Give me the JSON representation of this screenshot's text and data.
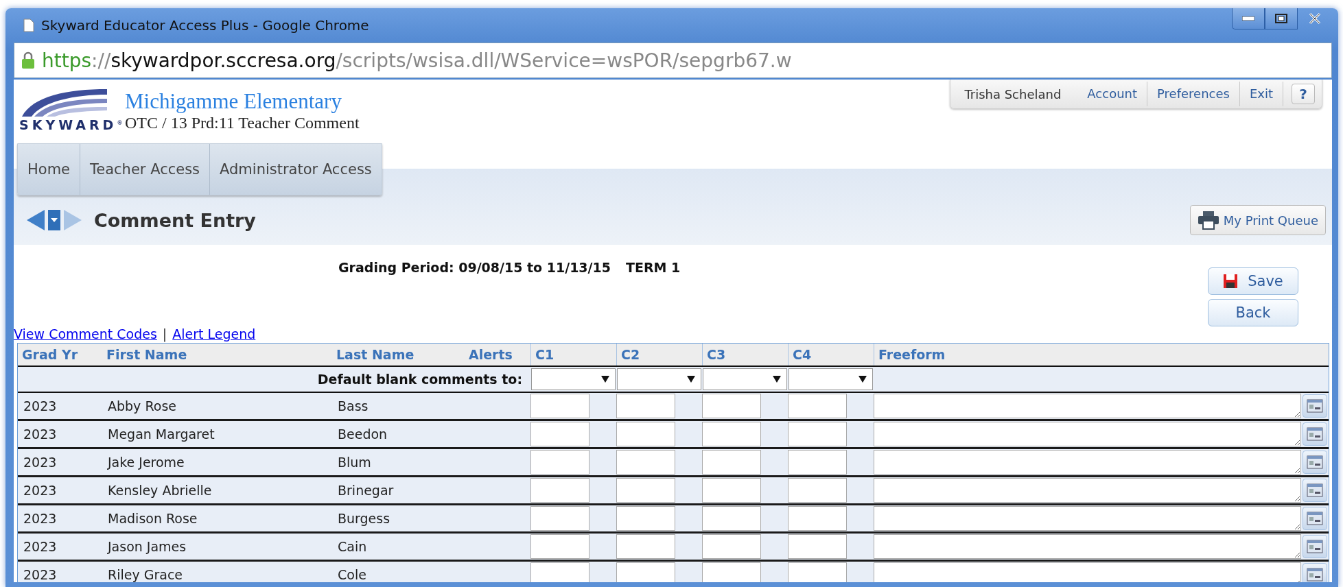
{
  "window": {
    "title": "Skyward Educator Access Plus - Google Chrome"
  },
  "address_bar": {
    "scheme": "https",
    "separator": "://",
    "host": "skywardpor.sccresa.org",
    "path": "/scripts/wsisa.dll/WService=wsPOR/sepgrb67.w"
  },
  "header": {
    "logo_text": "SKYWARD$^{®}$",
    "school": "Michigamme Elementary",
    "subtitle": "OTC / 13 Prd:11 Teacher Comment"
  },
  "user_menu": {
    "user": "Trisha Scheland",
    "links": [
      "Account",
      "Preferences",
      "Exit"
    ],
    "help": "?"
  },
  "nav": [
    "Home",
    "Teacher Access",
    "Administrator Access"
  ],
  "page": {
    "title": "Comment Entry",
    "print_queue": "My Print Queue"
  },
  "grading_period": {
    "label": "Grading Period: 09/08/15 to 11/13/15",
    "term": "TERM 1"
  },
  "buttons": [
    "Save",
    "Back"
  ],
  "links": [
    "View Comment Codes",
    "Alert Legend"
  ],
  "link_separator": "|",
  "table": {
    "columns": [
      "Grad Yr",
      "First Name",
      "Last Name",
      "Alerts",
      "C1",
      "C2",
      "C3",
      "C4",
      "Freeform"
    ],
    "default_label": "Default blank comments to:",
    "rows": [
      {
        "grad_yr": "2023",
        "first_name": "Abby Rose",
        "last_name": "Bass"
      },
      {
        "grad_yr": "2023",
        "first_name": "Megan Margaret",
        "last_name": "Beedon"
      },
      {
        "grad_yr": "2023",
        "first_name": "Jake Jerome",
        "last_name": "Blum"
      },
      {
        "grad_yr": "2023",
        "first_name": "Kensley Abrielle",
        "last_name": "Brinegar"
      },
      {
        "grad_yr": "2023",
        "first_name": "Madison Rose",
        "last_name": "Burgess"
      },
      {
        "grad_yr": "2023",
        "first_name": "Jason James",
        "last_name": "Cain"
      },
      {
        "grad_yr": "2023",
        "first_name": "Riley Grace",
        "last_name": "Cole"
      }
    ]
  }
}
